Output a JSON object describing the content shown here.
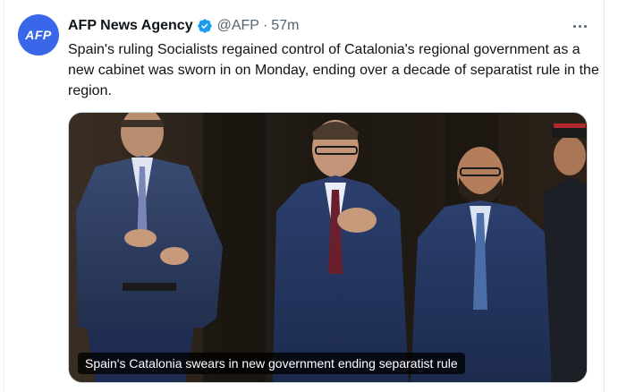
{
  "tweet": {
    "avatar_text": "AFP",
    "author_name": "AFP News Agency",
    "handle": "@AFP",
    "separator": "·",
    "time": "57m",
    "text": "Spain's ruling Socialists regained control of Catalonia's regional government as a new cabinet was sworn in on Monday, ending over a decade of separatist rule in the region.",
    "media_caption": "Spain's Catalonia swears in new government ending separatist rule"
  },
  "colors": {
    "avatar_bg": "#3a66ea",
    "verified": "#1d9bf0",
    "muted_text": "#536471"
  },
  "icons": {
    "verified": "verified-badge-icon",
    "more": "more-options-icon"
  }
}
